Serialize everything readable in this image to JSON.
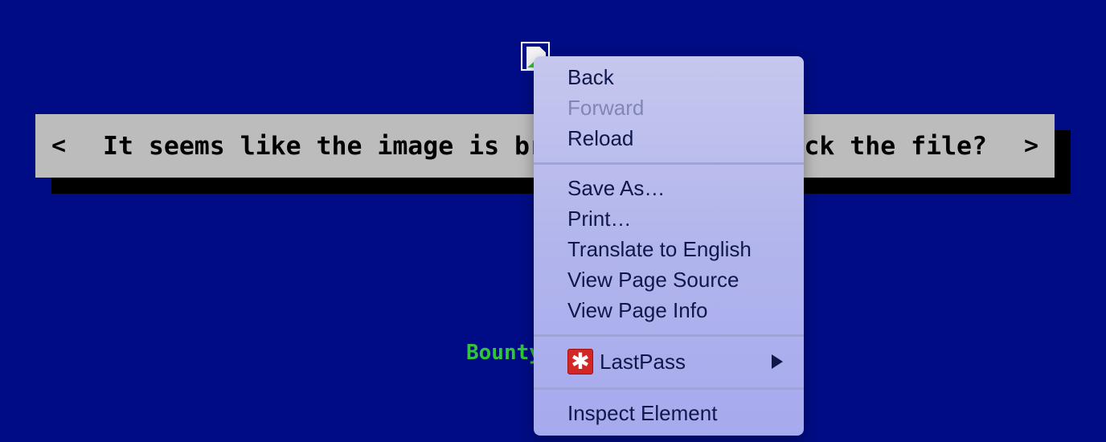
{
  "page": {
    "background_color": "#000c85",
    "banner": {
      "left_arrow": "<",
      "message": "It seems like the image is broken. Can you check the file?",
      "right_arrow": ">"
    },
    "bottom_text": "Bounty"
  },
  "broken_image_icon": "broken-image-icon",
  "context_menu": {
    "items": [
      {
        "label": "Back",
        "enabled": true
      },
      {
        "label": "Forward",
        "enabled": false
      },
      {
        "label": "Reload",
        "enabled": true
      },
      {
        "label": "Save As…",
        "enabled": true
      },
      {
        "label": "Print…",
        "enabled": true
      },
      {
        "label": "Translate to English",
        "enabled": true
      },
      {
        "label": "View Page Source",
        "enabled": true
      },
      {
        "label": "View Page Info",
        "enabled": true
      },
      {
        "label": "LastPass",
        "enabled": true,
        "icon": "lastpass-icon",
        "has_submenu": true
      },
      {
        "label": "Inspect Element",
        "enabled": true
      }
    ],
    "lastpass_icon_glyph": "✱"
  }
}
